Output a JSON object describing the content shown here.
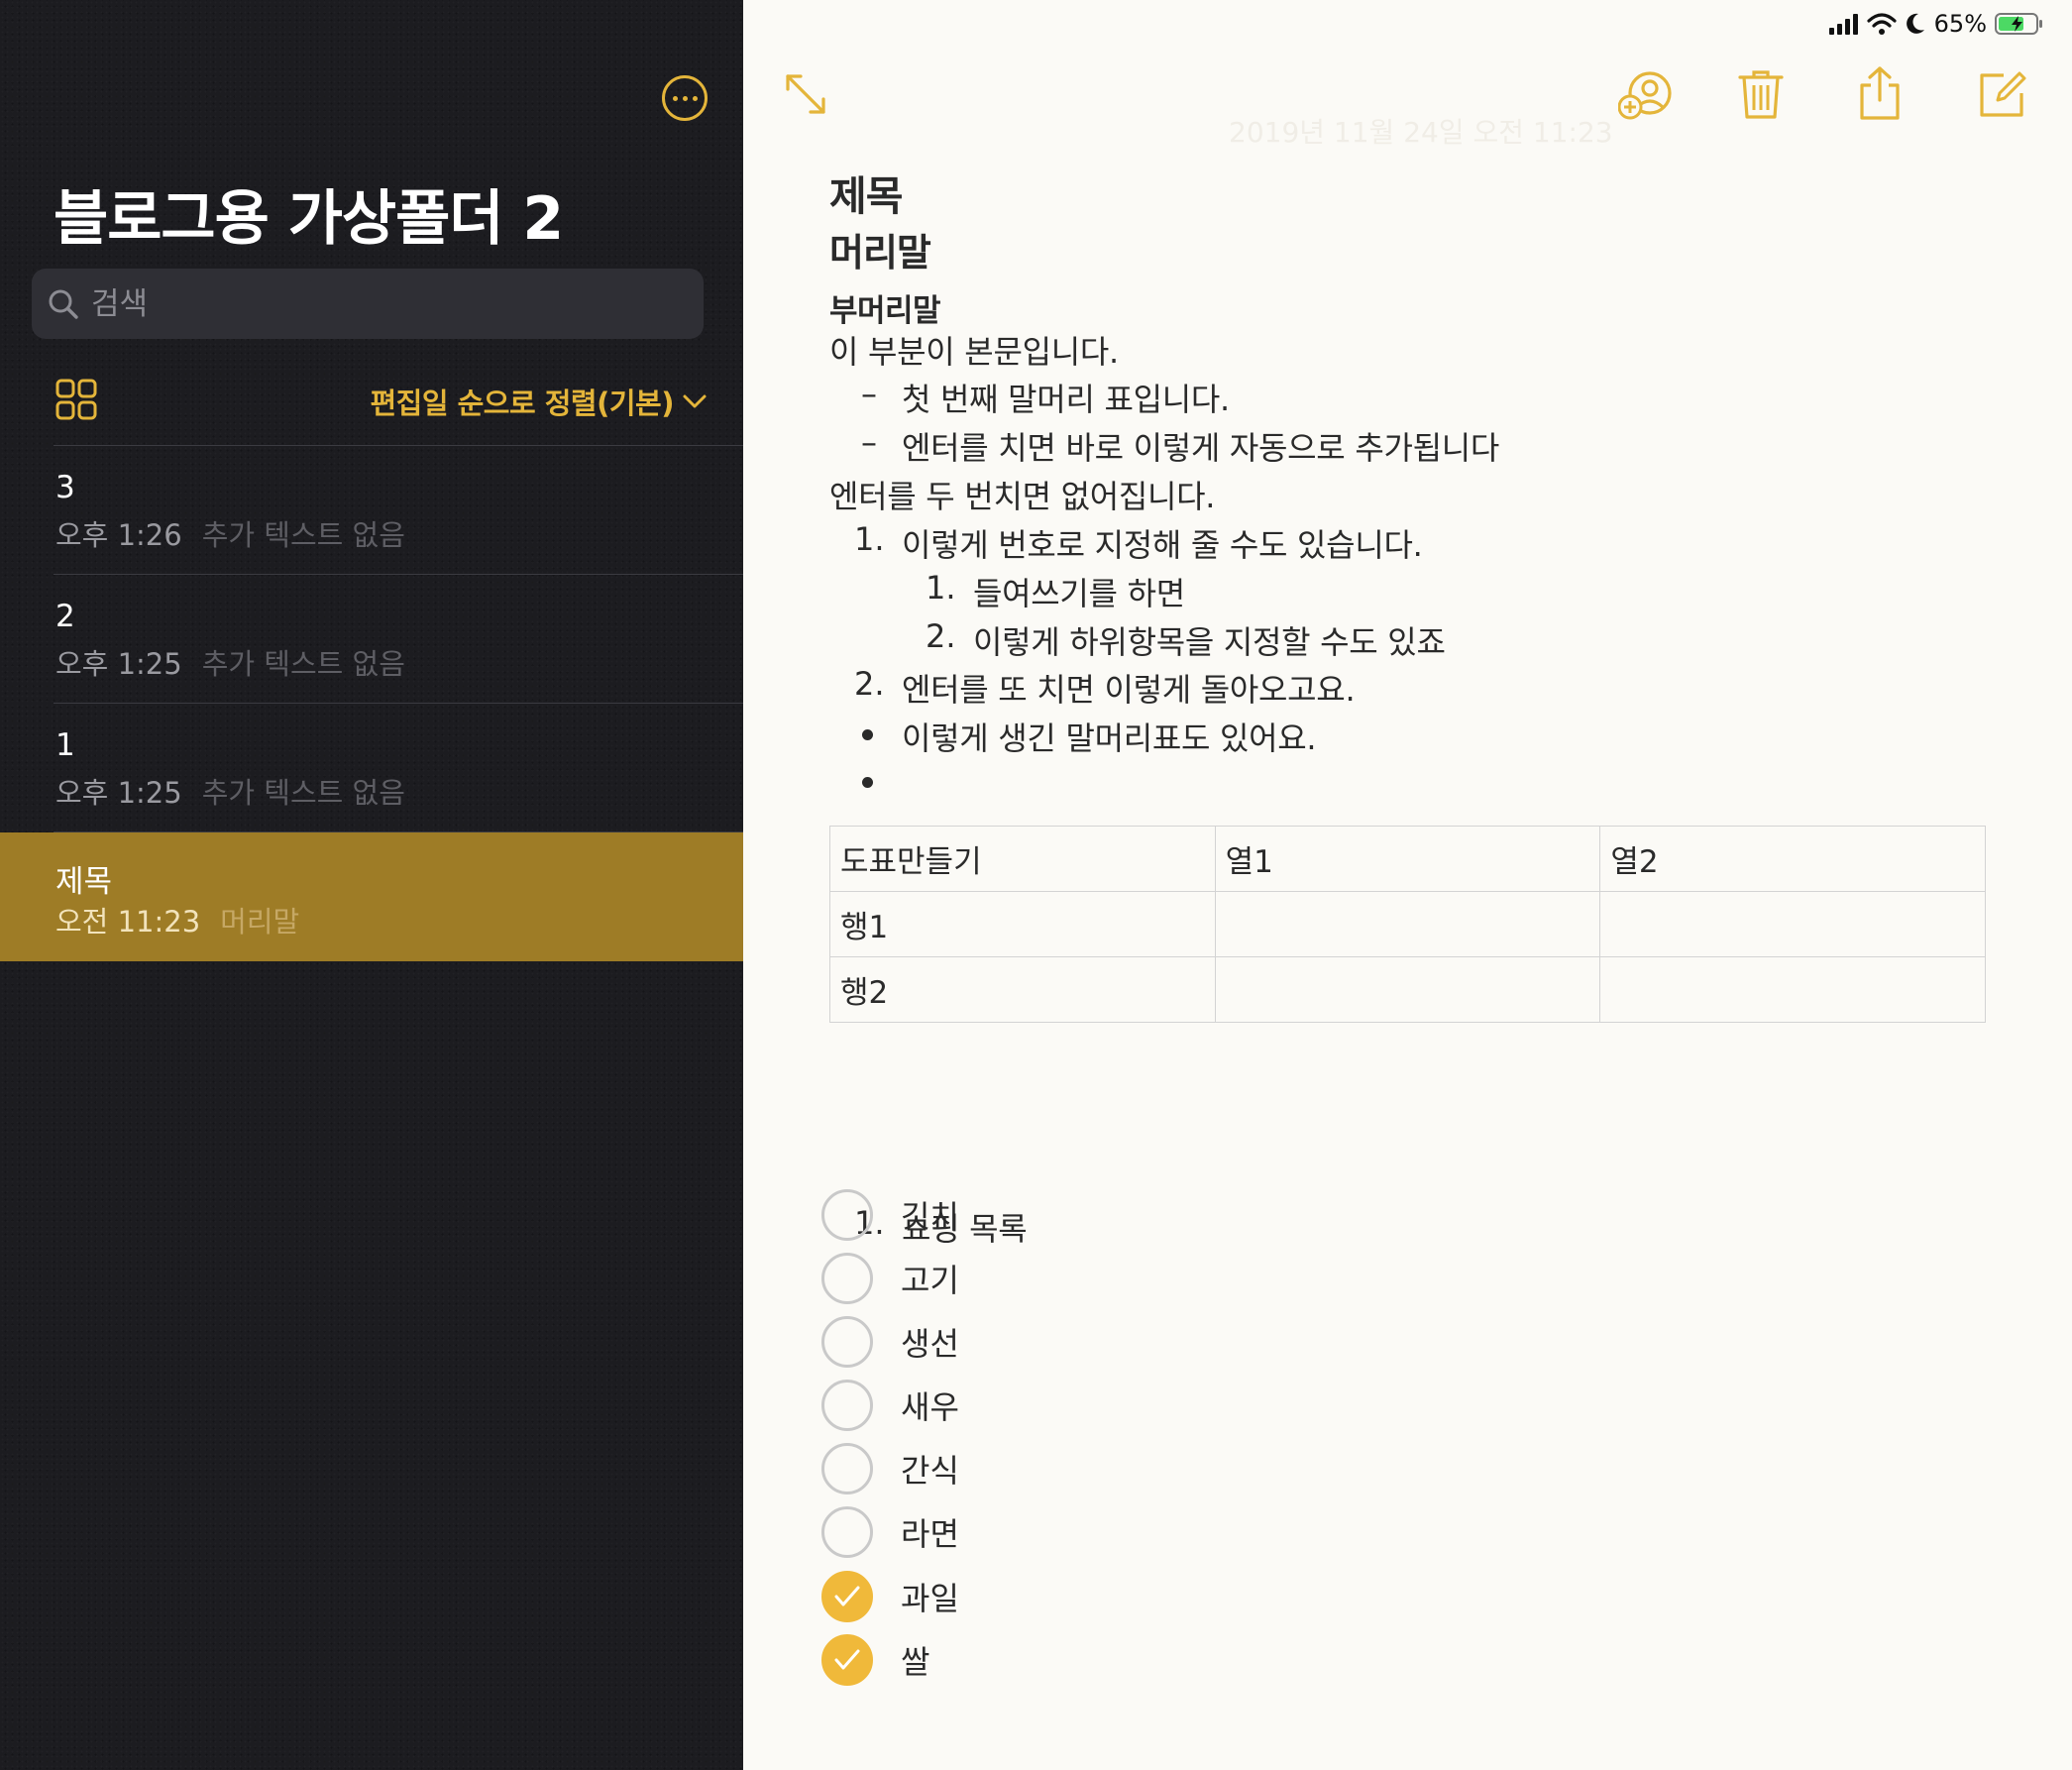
{
  "status": {
    "battery": "65%"
  },
  "sidebar": {
    "folder_title": "블로그용 가상폴더 2",
    "search_placeholder": "검색",
    "sort_label": "편집일 순으로 정렬(기본)",
    "notes": [
      {
        "title": "3",
        "time": "오후 1:26",
        "preview": "추가 텍스트 없음"
      },
      {
        "title": "2",
        "time": "오후 1:25",
        "preview": "추가 텍스트 없음"
      },
      {
        "title": "1",
        "time": "오후 1:25",
        "preview": "추가 텍스트 없음"
      },
      {
        "title": "제목",
        "time": "오전 11:23",
        "preview": "머리말"
      }
    ]
  },
  "editor": {
    "date": "2019년 11월 24일 오전 11:23",
    "title": "제목",
    "heading": "머리말",
    "subheading": "부머리말",
    "body": "이 부분이 본문입니다.",
    "dash_items": [
      "첫 번째 말머리 표입니다.",
      "엔터를 치면 바로 이렇게 자동으로 추가됩니다"
    ],
    "dash_marker": "–",
    "after_dash": "엔터를 두 번치면 없어집니다.",
    "numbered": [
      {
        "num": "1.",
        "text": "이렇게 번호로 지정해 줄 수도 있습니다."
      },
      {
        "num": "1.",
        "text": "들여쓰기를 하면"
      },
      {
        "num": "2.",
        "text": "이렇게 하위항목을 지정할 수도 있죠"
      },
      {
        "num": "2.",
        "text": "엔터를 또 치면 이렇게 돌아오고요."
      }
    ],
    "bullet_item": "이렇게 생긴 말머리표도 있어요.",
    "table": {
      "header": [
        "도표만들기",
        "열1",
        "열2"
      ],
      "rows": [
        [
          "행1",
          "",
          ""
        ],
        [
          "행2",
          "",
          ""
        ]
      ]
    },
    "shopping": {
      "num": "1.",
      "text": "쇼핑 목록"
    },
    "checklist": [
      {
        "label": "김치",
        "checked": false
      },
      {
        "label": "고기",
        "checked": false
      },
      {
        "label": "생선",
        "checked": false
      },
      {
        "label": "새우",
        "checked": false
      },
      {
        "label": "간식",
        "checked": false
      },
      {
        "label": "라면",
        "checked": false
      },
      {
        "label": "과일",
        "checked": true
      },
      {
        "label": "쌀",
        "checked": true
      }
    ]
  },
  "colors": {
    "accent": "#e4b53a",
    "selected_row": "#9e7c26",
    "sidebar_bg": "#1c1c20"
  }
}
